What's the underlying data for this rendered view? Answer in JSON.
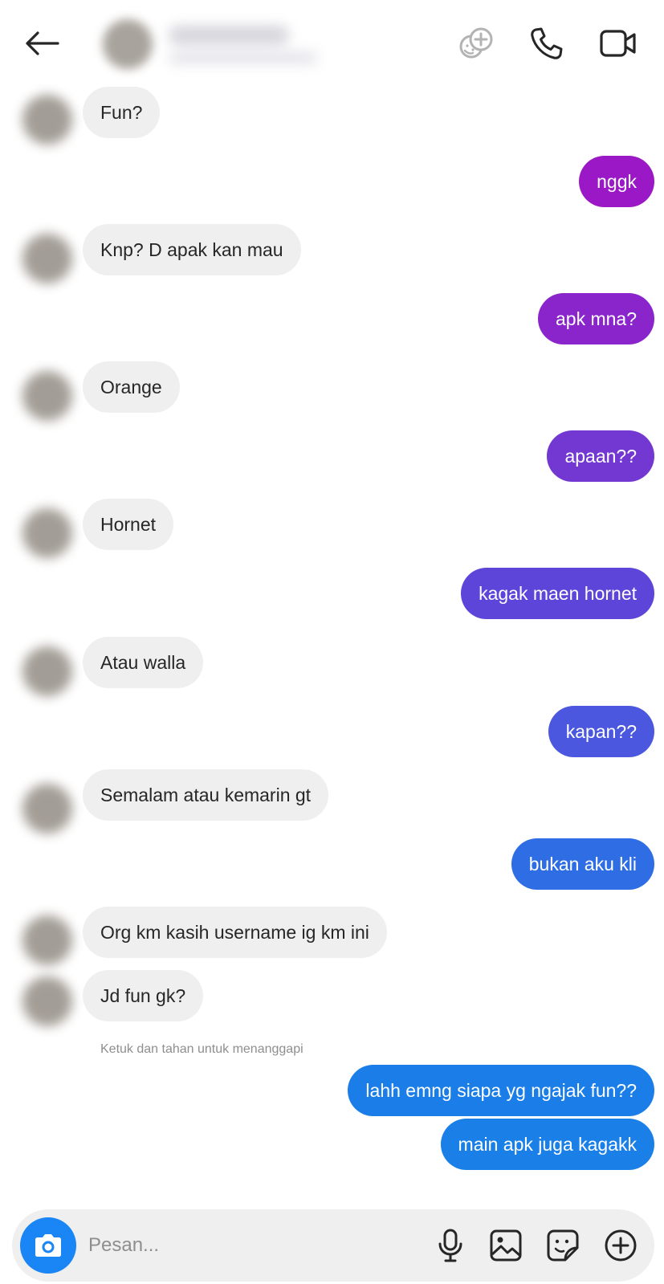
{
  "header": {
    "contact_name": "",
    "icons": [
      "back-arrow-icon",
      "effects-icon",
      "phone-call-icon",
      "video-call-icon"
    ]
  },
  "messages": [
    {
      "side": "in",
      "text": "Fun?"
    },
    {
      "side": "out",
      "text": "nggk",
      "color": "#9a18c6"
    },
    {
      "side": "in",
      "text": "Knp? D apak kan mau"
    },
    {
      "side": "out",
      "text": "apk mna?",
      "color": "#8a25cc"
    },
    {
      "side": "in",
      "text": "Orange"
    },
    {
      "side": "out",
      "text": "apaan??",
      "color": "#7438d2"
    },
    {
      "side": "in",
      "text": "Hornet"
    },
    {
      "side": "out",
      "text": "kagak maen hornet",
      "color": "#5c45d8"
    },
    {
      "side": "in",
      "text": "Atau walla"
    },
    {
      "side": "out",
      "text": "kapan??",
      "color": "#4a57de"
    },
    {
      "side": "in",
      "text": "Semalam atau kemarin gt"
    },
    {
      "side": "out",
      "text": "bukan aku kli",
      "color": "#2e6de4"
    },
    {
      "side": "in",
      "text": "Org km kasih username ig km ini"
    },
    {
      "side": "in",
      "text": "Jd fun gk?"
    },
    {
      "side": "out",
      "text": "lahh emng siapa yg ngajak fun??",
      "color": "#1a7de8"
    },
    {
      "side": "out",
      "text": "main apk juga kagakk",
      "color": "#1a80e8"
    }
  ],
  "hint_text": "Ketuk dan tahan untuk menanggapi",
  "composer": {
    "placeholder": "Pesan...",
    "camera_color": "#1a85f4",
    "icons": [
      "camera-icon",
      "microphone-icon",
      "gallery-icon",
      "sticker-icon",
      "plus-icon"
    ]
  }
}
